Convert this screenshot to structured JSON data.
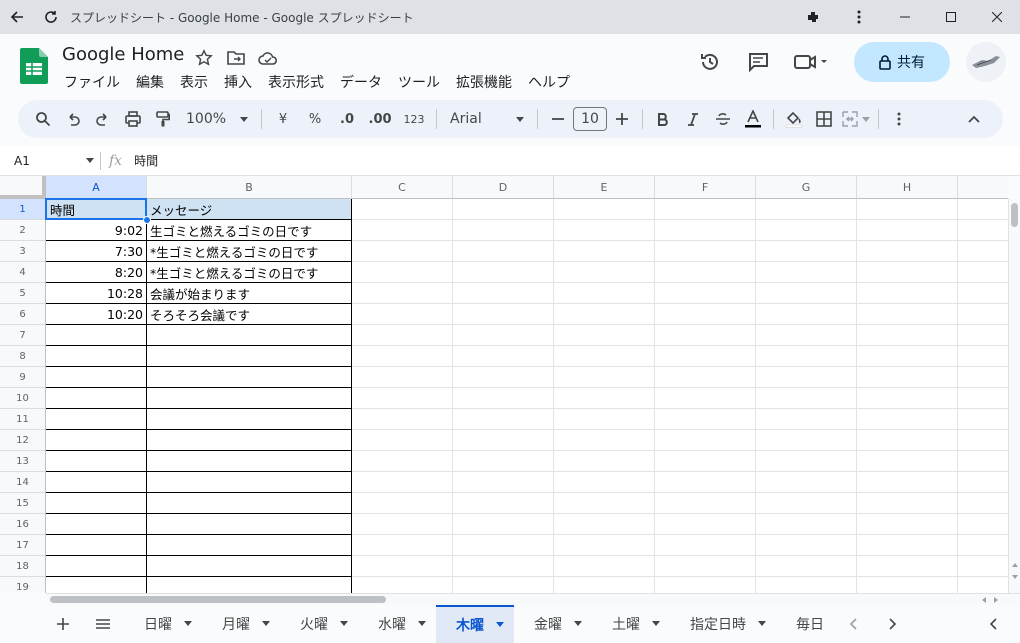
{
  "window": {
    "title": "スプレッドシート - Google Home - Google スプレッドシート"
  },
  "doc": {
    "title": "Google Home"
  },
  "menu": [
    "ファイル",
    "編集",
    "表示",
    "挿入",
    "表示形式",
    "データ",
    "ツール",
    "拡張機能",
    "ヘルプ"
  ],
  "share": {
    "label": "共有"
  },
  "toolbar": {
    "zoom": "100%",
    "currency": "¥",
    "percent": "%",
    "dec_dec": ".0",
    "dec_inc": ".00",
    "format123": "123",
    "font": "Arial",
    "font_size": "10"
  },
  "formula_bar": {
    "cell_ref": "A1",
    "content": "時間"
  },
  "columns": [
    "A",
    "B",
    "C",
    "D",
    "E",
    "F",
    "G",
    "H"
  ],
  "rows": [
    "1",
    "2",
    "3",
    "4",
    "5",
    "6",
    "7",
    "8",
    "9",
    "10",
    "11",
    "12",
    "13",
    "14",
    "15",
    "16",
    "17",
    "18",
    "19"
  ],
  "table": [
    [
      "時間",
      "メッセージ"
    ],
    [
      "9:02",
      "生ゴミと燃えるゴミの日です"
    ],
    [
      "7:30",
      "*生ゴミと燃えるゴミの日です"
    ],
    [
      "8:20",
      "*生ゴミと燃えるゴミの日です"
    ],
    [
      "10:28",
      "会議が始まります"
    ],
    [
      "10:20",
      "そろそろ会議です"
    ]
  ],
  "sheets": [
    "日曜",
    "月曜",
    "火曜",
    "水曜",
    "木曜",
    "金曜",
    "土曜",
    "指定日時",
    "毎日"
  ],
  "active_sheet": "木曜",
  "colors": {
    "accent": "#0b57d0",
    "share_bg": "#c2e7ff",
    "selected_header": "#cfe2f3",
    "sheets_green": "#0f9d58"
  }
}
